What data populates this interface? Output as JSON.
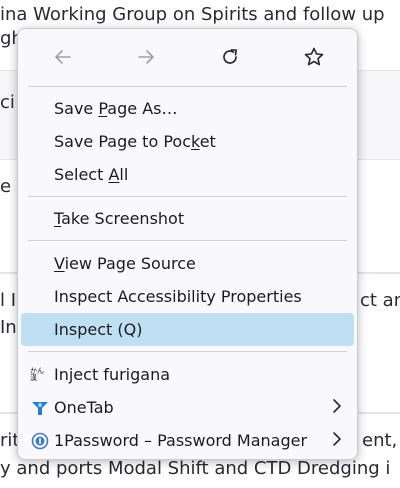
{
  "background": {
    "line1": "ina Working Group on Spirits and follow up",
    "line2": "gh",
    "line3": "ci",
    "line4": "e",
    "line5a": "l I",
    "line5b": "ct an",
    "line6": "In",
    "line7a": "rit",
    "line7b": "ent,",
    "line8": "y and ports Modal Shift and CTD Dredging i"
  },
  "navigation": {
    "back": "arrow-left-icon",
    "forward": "arrow-right-icon",
    "reload": "reload-icon",
    "bookmark": "star-icon"
  },
  "menu": {
    "save_page_as": {
      "pre": "Save ",
      "key": "P",
      "post": "age As…"
    },
    "save_to_pocket": {
      "pre": "Save Page to Poc",
      "key": "k",
      "post": "et"
    },
    "select_all": {
      "pre": "Select ",
      "key": "A",
      "post": "ll"
    },
    "take_screenshot": {
      "pre": "",
      "key": "T",
      "post": "ake Screenshot"
    },
    "view_page_source": {
      "pre": "",
      "key": "V",
      "post": "iew Page Source"
    },
    "inspect_accessibility": "Inspect Accessibility Properties",
    "inspect": "Inspect (Q)",
    "inject_furigana": "Inject furigana",
    "onetab": "OneTab",
    "onepassword": "1Password – Password Manager",
    "furigana_icon_text": "かん漢"
  },
  "colors": {
    "highlight": "#bfe0f2",
    "onetab": "#1f7dd6",
    "onepassword": "#3a7bd5"
  }
}
